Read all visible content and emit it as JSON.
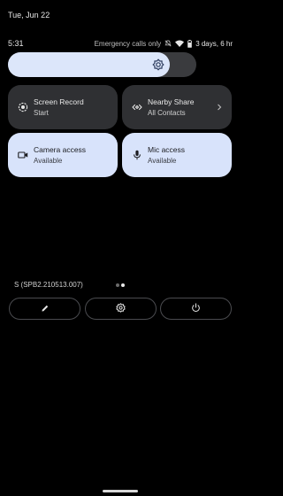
{
  "header": {
    "date": "Tue, Jun 22",
    "time": "5:31",
    "emergency_text": "Emergency calls only",
    "battery_text": "3 days, 6 hr"
  },
  "brightness": {
    "level_percent": 86,
    "icon": "brightness-icon"
  },
  "tiles": [
    {
      "title": "Screen Record",
      "subtitle": "Start",
      "icon": "screen-record-icon",
      "active": false
    },
    {
      "title": "Nearby Share",
      "subtitle": "All Contacts",
      "icon": "nearby-share-icon",
      "active": false,
      "has_chevron": true
    },
    {
      "title": "Camera access",
      "subtitle": "Available",
      "icon": "camera-icon",
      "active": true
    },
    {
      "title": "Mic access",
      "subtitle": "Available",
      "icon": "mic-icon",
      "active": true
    }
  ],
  "footer": {
    "build": "S (SPB2.210513.007)",
    "page_count": 2,
    "current_page": 2,
    "buttons": [
      "edit-icon",
      "settings-icon",
      "power-icon"
    ]
  },
  "colors": {
    "background": "#000000",
    "tile_dark": "#2f3033",
    "tile_light": "#d8e3fb",
    "slider_fill": "#dce6fa"
  }
}
